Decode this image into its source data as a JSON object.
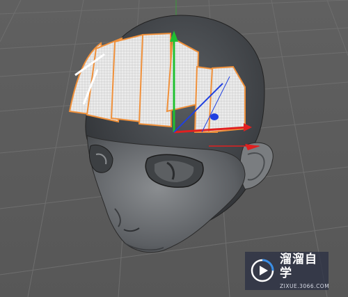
{
  "viewport": {
    "background_color": "#5c5c5c",
    "grid_color": "#6e6e6e",
    "selection_color": "#f0903a",
    "axis_colors": {
      "x": "#e02020",
      "y": "#20c030",
      "z": "#2040e0"
    }
  },
  "watermark": {
    "title": "溜溜自学",
    "url": "ZIXUE.3066.COM",
    "logo_icon": "play-triangle-icon"
  }
}
